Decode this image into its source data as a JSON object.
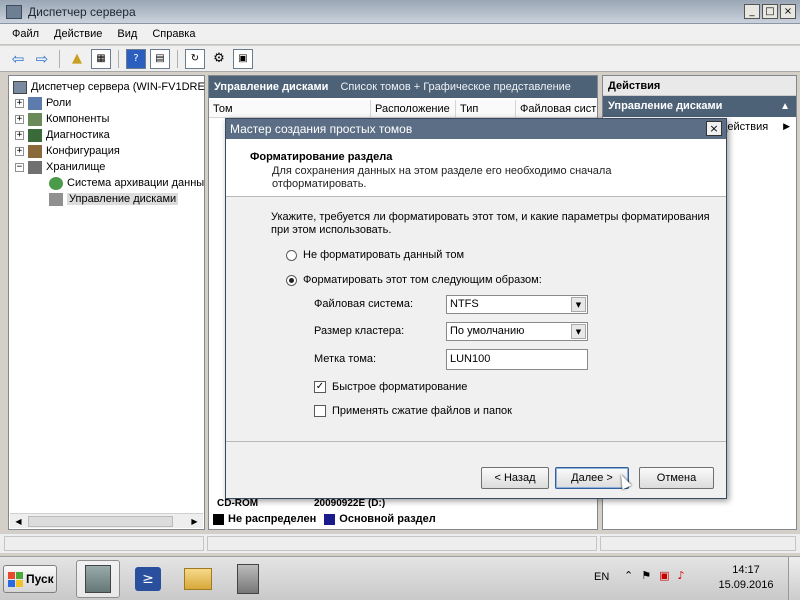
{
  "window": {
    "title": "Диспетчер сервера",
    "minimize": "_",
    "maximize": "□",
    "close": "×"
  },
  "menu": [
    "Файл",
    "Действие",
    "Вид",
    "Справка"
  ],
  "tree": {
    "root": "Диспетчер сервера (WIN-FV1DRE",
    "items": [
      {
        "label": "Роли",
        "expander": "+"
      },
      {
        "label": "Компоненты",
        "expander": "+"
      },
      {
        "label": "Диагностика",
        "expander": "+"
      },
      {
        "label": "Конфигурация",
        "expander": "+"
      },
      {
        "label": "Хранилище",
        "expander": "−"
      },
      {
        "label": "Система архивации данны",
        "expander": ""
      },
      {
        "label": "Управление дисками",
        "expander": ""
      }
    ]
  },
  "center": {
    "title": "Управление дисками",
    "subtitle": "Список томов + Графическое представление",
    "columns": [
      "Том",
      "Расположение",
      "Тип",
      "Файловая сист"
    ],
    "cdrom_label": "CD-ROM",
    "cdrom_volume": "20090922E  (D:)",
    "legend": [
      {
        "label": "Не распределен",
        "color": "#000000"
      },
      {
        "label": "Основной раздел",
        "color": "#1a1a8a"
      }
    ]
  },
  "actions": {
    "header": "Действия",
    "section": "Управление дисками",
    "item": "действия"
  },
  "dialog": {
    "title": "Мастер создания простых томов",
    "header_title": "Форматирование раздела",
    "header_desc": "Для сохранения данных на этом разделе его необходимо сначала отформатировать.",
    "instruction": "Укажите, требуется ли форматировать этот том, и какие параметры форматирования при этом использовать.",
    "radio_no_format": "Не форматировать данный том",
    "radio_format": "Форматировать этот том следующим образом:",
    "fs_label": "Файловая система:",
    "fs_value": "NTFS",
    "cluster_label": "Размер кластера:",
    "cluster_value": "По умолчанию",
    "vol_label": "Метка тома:",
    "vol_value": "LUN100",
    "quick_format": "Быстрое форматирование",
    "compress": "Применять сжатие файлов и папок",
    "back_btn": "< Назад",
    "next_btn": "Далее >",
    "cancel_btn": "Отмена"
  },
  "taskbar": {
    "start": "Пуск",
    "lang": "EN",
    "time": "14:17",
    "date": "15.09.2016"
  }
}
